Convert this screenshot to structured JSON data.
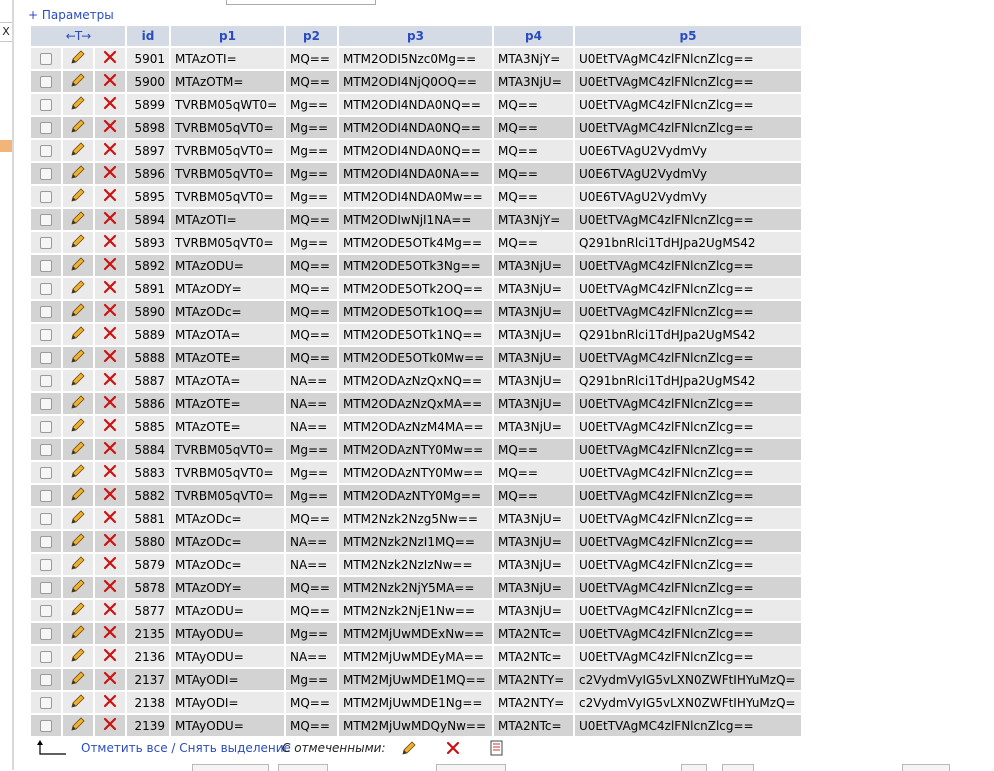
{
  "sidebar": {
    "close_label": "X"
  },
  "params_toggle": {
    "plus": "+",
    "label": "Параметры"
  },
  "table": {
    "sort_arrows": "←T→",
    "columns": [
      "id",
      "p1",
      "p2",
      "p3",
      "p4",
      "p5"
    ],
    "rows": [
      [
        "5901",
        "MTAzOTI=",
        "MQ==",
        "MTM2ODI5Nzc0Mg==",
        "MTA3NjY=",
        "U0EtTVAgMC4zlFNlcnZlcg=="
      ],
      [
        "5900",
        "MTAzOTM=",
        "MQ==",
        "MTM2ODI4NjQ0OQ==",
        "MTA3NjU=",
        "U0EtTVAgMC4zlFNlcnZlcg=="
      ],
      [
        "5899",
        "TVRBM05qWT0=",
        "Mg==",
        "MTM2ODI4NDA0NQ==",
        "MQ==",
        "U0EtTVAgMC4zlFNlcnZlcg=="
      ],
      [
        "5898",
        "TVRBM05qVT0=",
        "Mg==",
        "MTM2ODI4NDA0NQ==",
        "MQ==",
        "U0EtTVAgMC4zlFNlcnZlcg=="
      ],
      [
        "5897",
        "TVRBM05qVT0=",
        "Mg==",
        "MTM2ODI4NDA0NQ==",
        "MQ==",
        "U0E6TVAgU2VydmVy"
      ],
      [
        "5896",
        "TVRBM05qVT0=",
        "Mg==",
        "MTM2ODI4NDA0NA==",
        "MQ==",
        "U0E6TVAgU2VydmVy"
      ],
      [
        "5895",
        "TVRBM05qVT0=",
        "Mg==",
        "MTM2ODI4NDA0Mw==",
        "MQ==",
        "U0E6TVAgU2VydmVy"
      ],
      [
        "5894",
        "MTAzOTI=",
        "MQ==",
        "MTM2ODIwNjI1NA==",
        "MTA3NjY=",
        "U0EtTVAgMC4zlFNlcnZlcg=="
      ],
      [
        "5893",
        "TVRBM05qVT0=",
        "Mg==",
        "MTM2ODE5OTk4Mg==",
        "MQ==",
        "Q291bnRlci1TdHJpa2UgMS42"
      ],
      [
        "5892",
        "MTAzODU=",
        "MQ==",
        "MTM2ODE5OTk3Ng==",
        "MTA3NjU=",
        "U0EtTVAgMC4zlFNlcnZlcg=="
      ],
      [
        "5891",
        "MTAzODY=",
        "MQ==",
        "MTM2ODE5OTk2OQ==",
        "MTA3NjU=",
        "U0EtTVAgMC4zlFNlcnZlcg=="
      ],
      [
        "5890",
        "MTAzODc=",
        "MQ==",
        "MTM2ODE5OTk1OQ==",
        "MTA3NjU=",
        "U0EtTVAgMC4zlFNlcnZlcg=="
      ],
      [
        "5889",
        "MTAzOTA=",
        "MQ==",
        "MTM2ODE5OTk1NQ==",
        "MTA3NjU=",
        "Q291bnRlci1TdHJpa2UgMS42"
      ],
      [
        "5888",
        "MTAzOTE=",
        "MQ==",
        "MTM2ODE5OTk0Mw==",
        "MTA3NjU=",
        "U0EtTVAgMC4zlFNlcnZlcg=="
      ],
      [
        "5887",
        "MTAzOTA=",
        "NA==",
        "MTM2ODAzNzQxNQ==",
        "MTA3NjU=",
        "Q291bnRlci1TdHJpa2UgMS42"
      ],
      [
        "5886",
        "MTAzOTE=",
        "NA==",
        "MTM2ODAzNzQxMA==",
        "MTA3NjU=",
        "U0EtTVAgMC4zlFNlcnZlcg=="
      ],
      [
        "5885",
        "MTAzOTE=",
        "NA==",
        "MTM2ODAzNzM4MA==",
        "MTA3NjU=",
        "U0EtTVAgMC4zlFNlcnZlcg=="
      ],
      [
        "5884",
        "TVRBM05qVT0=",
        "Mg==",
        "MTM2ODAzNTY0Mw==",
        "MQ==",
        "U0EtTVAgMC4zlFNlcnZlcg=="
      ],
      [
        "5883",
        "TVRBM05qVT0=",
        "Mg==",
        "MTM2ODAzNTY0Mw==",
        "MQ==",
        "U0EtTVAgMC4zlFNlcnZlcg=="
      ],
      [
        "5882",
        "TVRBM05qVT0=",
        "Mg==",
        "MTM2ODAzNTY0Mg==",
        "MQ==",
        "U0EtTVAgMC4zlFNlcnZlcg=="
      ],
      [
        "5881",
        "MTAzODc=",
        "MQ==",
        "MTM2Nzk2Nzg5Nw==",
        "MTA3NjU=",
        "U0EtTVAgMC4zlFNlcnZlcg=="
      ],
      [
        "5880",
        "MTAzODc=",
        "NA==",
        "MTM2Nzk2NzI1MQ==",
        "MTA3NjU=",
        "U0EtTVAgMC4zlFNlcnZlcg=="
      ],
      [
        "5879",
        "MTAzODc=",
        "NA==",
        "MTM2Nzk2NzIzNw==",
        "MTA3NjU=",
        "U0EtTVAgMC4zlFNlcnZlcg=="
      ],
      [
        "5878",
        "MTAzODY=",
        "MQ==",
        "MTM2Nzk2NjY5MA==",
        "MTA3NjU=",
        "U0EtTVAgMC4zlFNlcnZlcg=="
      ],
      [
        "5877",
        "MTAzODU=",
        "MQ==",
        "MTM2Nzk2NjE1Nw==",
        "MTA3NjU=",
        "U0EtTVAgMC4zlFNlcnZlcg=="
      ],
      [
        "2135",
        "MTAyODU=",
        "Mg==",
        "MTM2MjUwMDExNw==",
        "MTA2NTc=",
        "U0EtTVAgMC4zlFNlcnZlcg=="
      ],
      [
        "2136",
        "MTAyODU=",
        "NA==",
        "MTM2MjUwMDEyMA==",
        "MTA2NTc=",
        "U0EtTVAgMC4zlFNlcnZlcg=="
      ],
      [
        "2137",
        "MTAyODI=",
        "Mg==",
        "MTM2MjUwMDE1MQ==",
        "MTA2NTY=",
        "c2VydmVyIG5vLXN0ZWFtIHYuMzQ="
      ],
      [
        "2138",
        "MTAyODI=",
        "MQ==",
        "MTM2MjUwMDE1Ng==",
        "MTA2NTY=",
        "c2VydmVyIG5vLXN0ZWFtIHYuMzQ="
      ],
      [
        "2139",
        "MTAyODU=",
        "MQ==",
        "MTM2MjUwMDQyNw==",
        "MTA2NTc=",
        "U0EtTVAgMC4zlFNlcnZlcg=="
      ]
    ]
  },
  "footer": {
    "check_all": "Отметить все",
    "separator": " / ",
    "uncheck_all": "Снять выделение",
    "with_selected": "С отмеченными:"
  },
  "colors": {
    "link": "#2a4cc0",
    "delete": "#cc1111",
    "row_light": "#eaeaea",
    "row_dark": "#d3d3d3",
    "header": "#d5dbe4"
  },
  "icons": {
    "edit": "pencil-icon",
    "delete": "delete-x-icon",
    "export": "export-icon",
    "arrow": "arrow-up-left-icon"
  }
}
